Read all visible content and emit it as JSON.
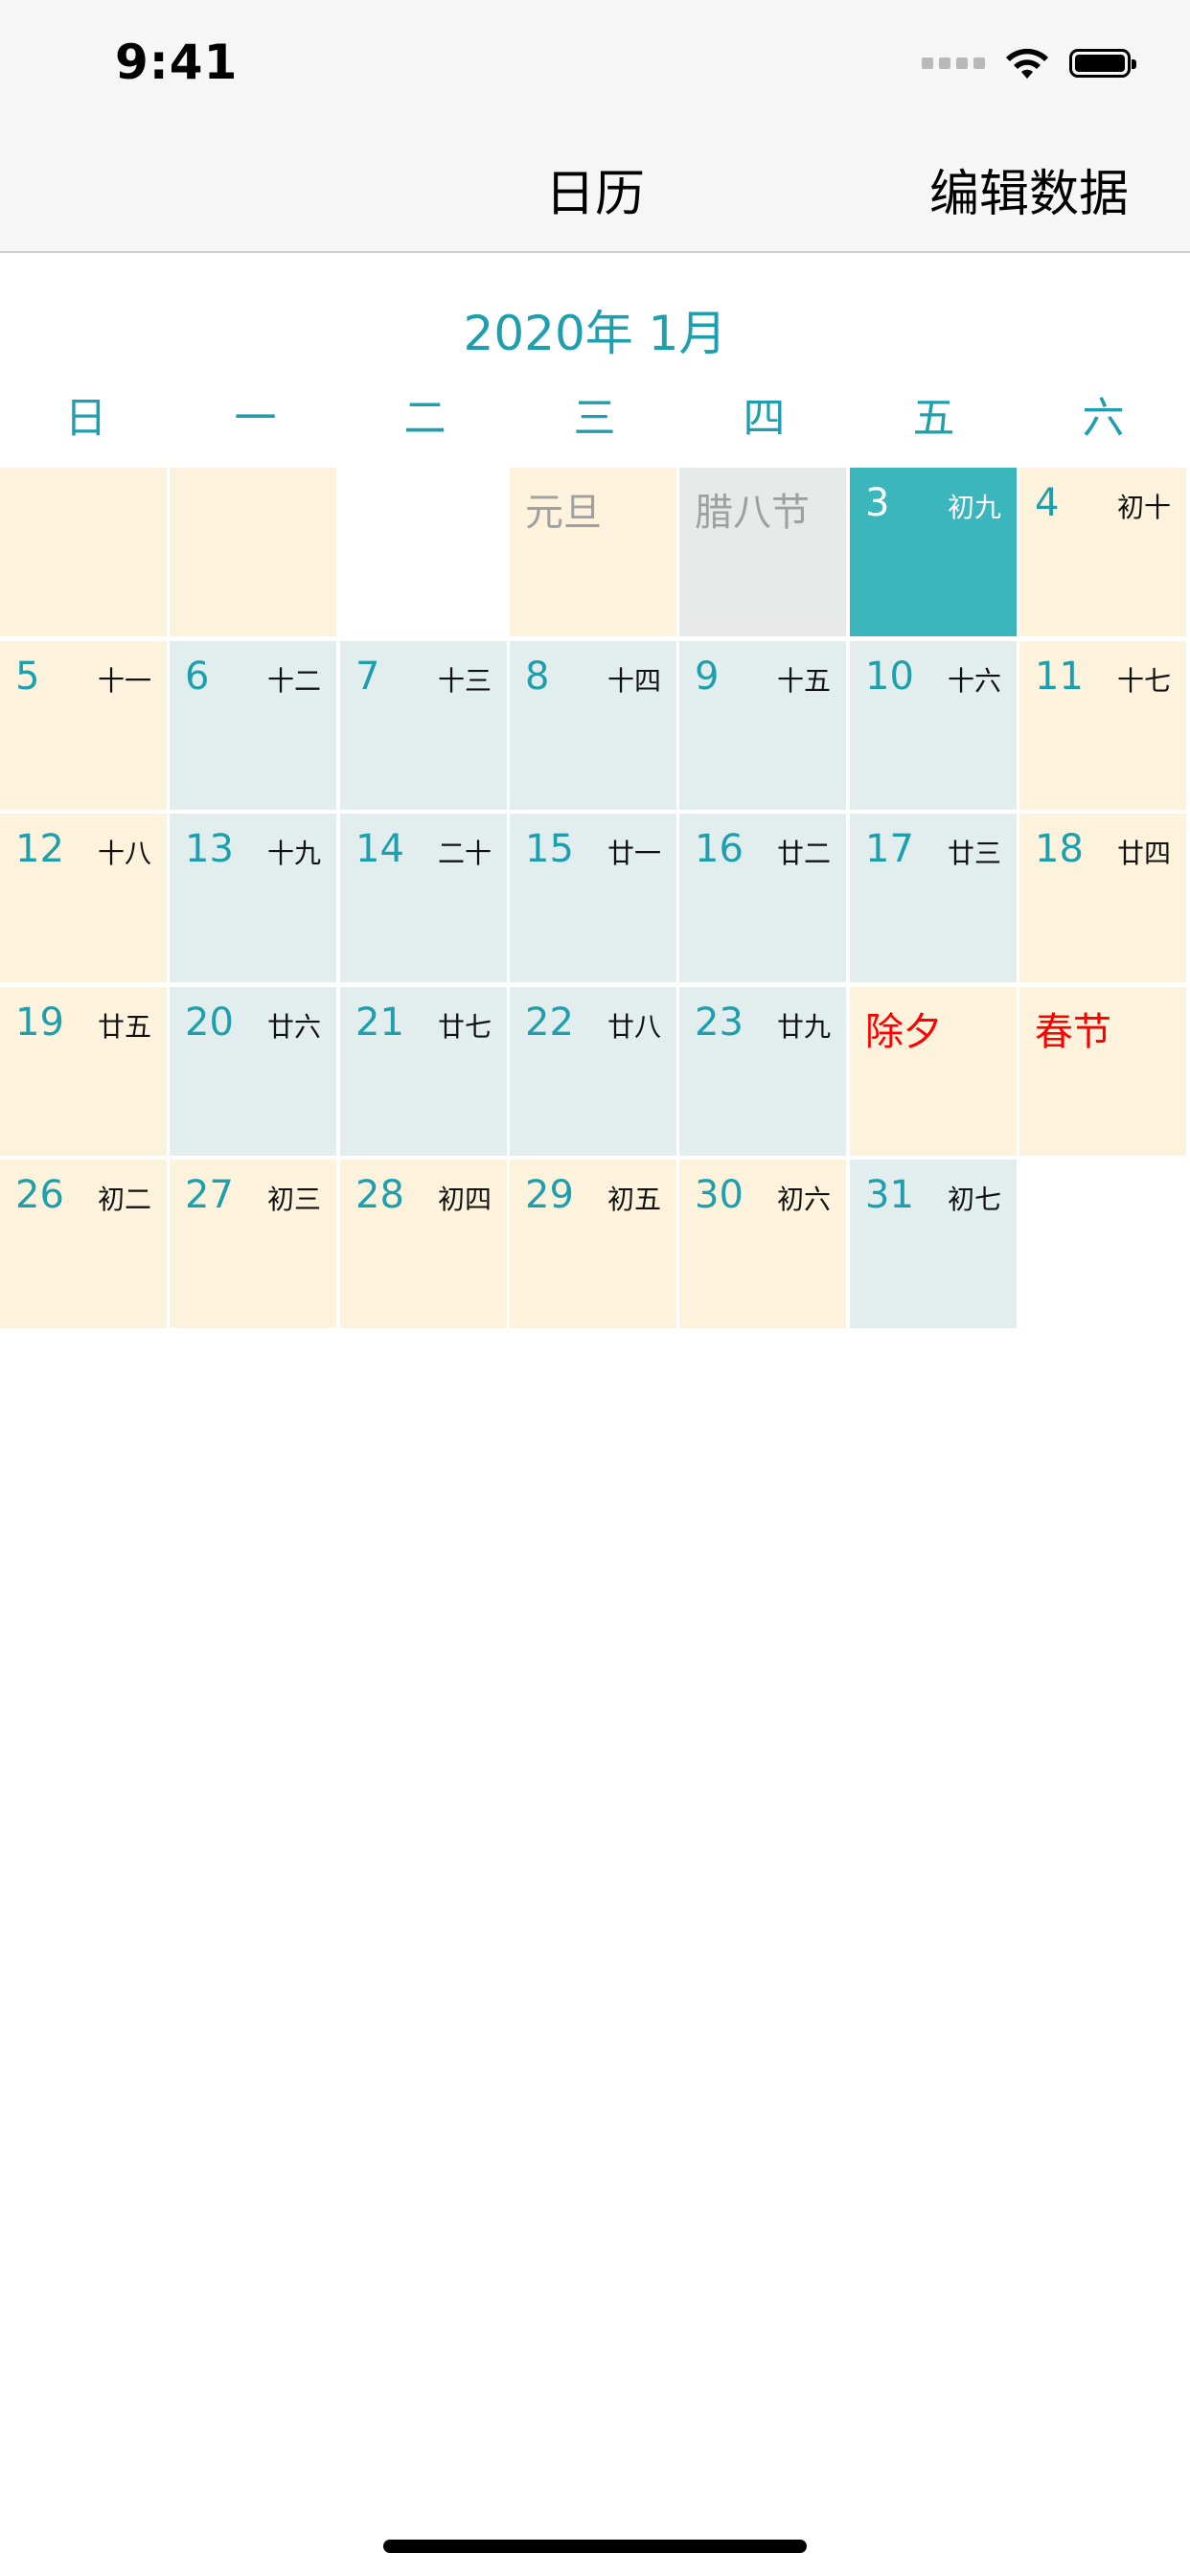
{
  "status_bar": {
    "time": "9:41"
  },
  "nav": {
    "title": "日历",
    "right_button": "编辑数据"
  },
  "calendar": {
    "month_title": "2020年 1月",
    "weekdays": [
      "日",
      "一",
      "二",
      "三",
      "四",
      "五",
      "六"
    ],
    "colors": {
      "accent": "#1f9fae",
      "selected": "#3bb6bc",
      "weekend": "#fdf3dc",
      "weekday": "#e2edee",
      "holiday_red": "#ff0000"
    },
    "cells": [
      {
        "col": 0,
        "row": 0,
        "bg": "yellow"
      },
      {
        "col": 1,
        "row": 0,
        "bg": "yellow"
      },
      {
        "col": 3,
        "row": 0,
        "bg": "yellow",
        "festival": "元旦",
        "festival_color": "gray"
      },
      {
        "col": 4,
        "row": 0,
        "bg": "gray",
        "festival": "腊八节",
        "festival_color": "gray"
      },
      {
        "col": 5,
        "row": 0,
        "bg": "teal",
        "day": "3",
        "lunar": "初九",
        "selected": true
      },
      {
        "col": 6,
        "row": 0,
        "bg": "yellow",
        "day": "4",
        "lunar": "初十"
      },
      {
        "col": 0,
        "row": 1,
        "bg": "yellow",
        "day": "5",
        "lunar": "十一"
      },
      {
        "col": 1,
        "row": 1,
        "bg": "blue",
        "day": "6",
        "lunar": "十二"
      },
      {
        "col": 2,
        "row": 1,
        "bg": "blue",
        "day": "7",
        "lunar": "十三"
      },
      {
        "col": 3,
        "row": 1,
        "bg": "blue",
        "day": "8",
        "lunar": "十四"
      },
      {
        "col": 4,
        "row": 1,
        "bg": "blue",
        "day": "9",
        "lunar": "十五"
      },
      {
        "col": 5,
        "row": 1,
        "bg": "blue",
        "day": "10",
        "lunar": "十六"
      },
      {
        "col": 6,
        "row": 1,
        "bg": "yellow",
        "day": "11",
        "lunar": "十七"
      },
      {
        "col": 0,
        "row": 2,
        "bg": "yellow",
        "day": "12",
        "lunar": "十八"
      },
      {
        "col": 1,
        "row": 2,
        "bg": "blue",
        "day": "13",
        "lunar": "十九"
      },
      {
        "col": 2,
        "row": 2,
        "bg": "blue",
        "day": "14",
        "lunar": "二十"
      },
      {
        "col": 3,
        "row": 2,
        "bg": "blue",
        "day": "15",
        "lunar": "廿一"
      },
      {
        "col": 4,
        "row": 2,
        "bg": "blue",
        "day": "16",
        "lunar": "廿二"
      },
      {
        "col": 5,
        "row": 2,
        "bg": "blue",
        "day": "17",
        "lunar": "廿三"
      },
      {
        "col": 6,
        "row": 2,
        "bg": "yellow",
        "day": "18",
        "lunar": "廿四"
      },
      {
        "col": 0,
        "row": 3,
        "bg": "yellow",
        "day": "19",
        "lunar": "廿五"
      },
      {
        "col": 1,
        "row": 3,
        "bg": "blue",
        "day": "20",
        "lunar": "廿六"
      },
      {
        "col": 2,
        "row": 3,
        "bg": "blue",
        "day": "21",
        "lunar": "廿七"
      },
      {
        "col": 3,
        "row": 3,
        "bg": "blue",
        "day": "22",
        "lunar": "廿八"
      },
      {
        "col": 4,
        "row": 3,
        "bg": "blue",
        "day": "23",
        "lunar": "廿九"
      },
      {
        "col": 5,
        "row": 3,
        "bg": "yellow",
        "festival": "除夕",
        "festival_color": "red"
      },
      {
        "col": 6,
        "row": 3,
        "bg": "yellow",
        "festival": "春节",
        "festival_color": "red"
      },
      {
        "col": 0,
        "row": 4,
        "bg": "yellow",
        "day": "26",
        "lunar": "初二"
      },
      {
        "col": 1,
        "row": 4,
        "bg": "yellow",
        "day": "27",
        "lunar": "初三"
      },
      {
        "col": 2,
        "row": 4,
        "bg": "yellow",
        "day": "28",
        "lunar": "初四"
      },
      {
        "col": 3,
        "row": 4,
        "bg": "yellow",
        "day": "29",
        "lunar": "初五"
      },
      {
        "col": 4,
        "row": 4,
        "bg": "yellow",
        "day": "30",
        "lunar": "初六"
      },
      {
        "col": 5,
        "row": 4,
        "bg": "blue",
        "day": "31",
        "lunar": "初七"
      }
    ]
  }
}
